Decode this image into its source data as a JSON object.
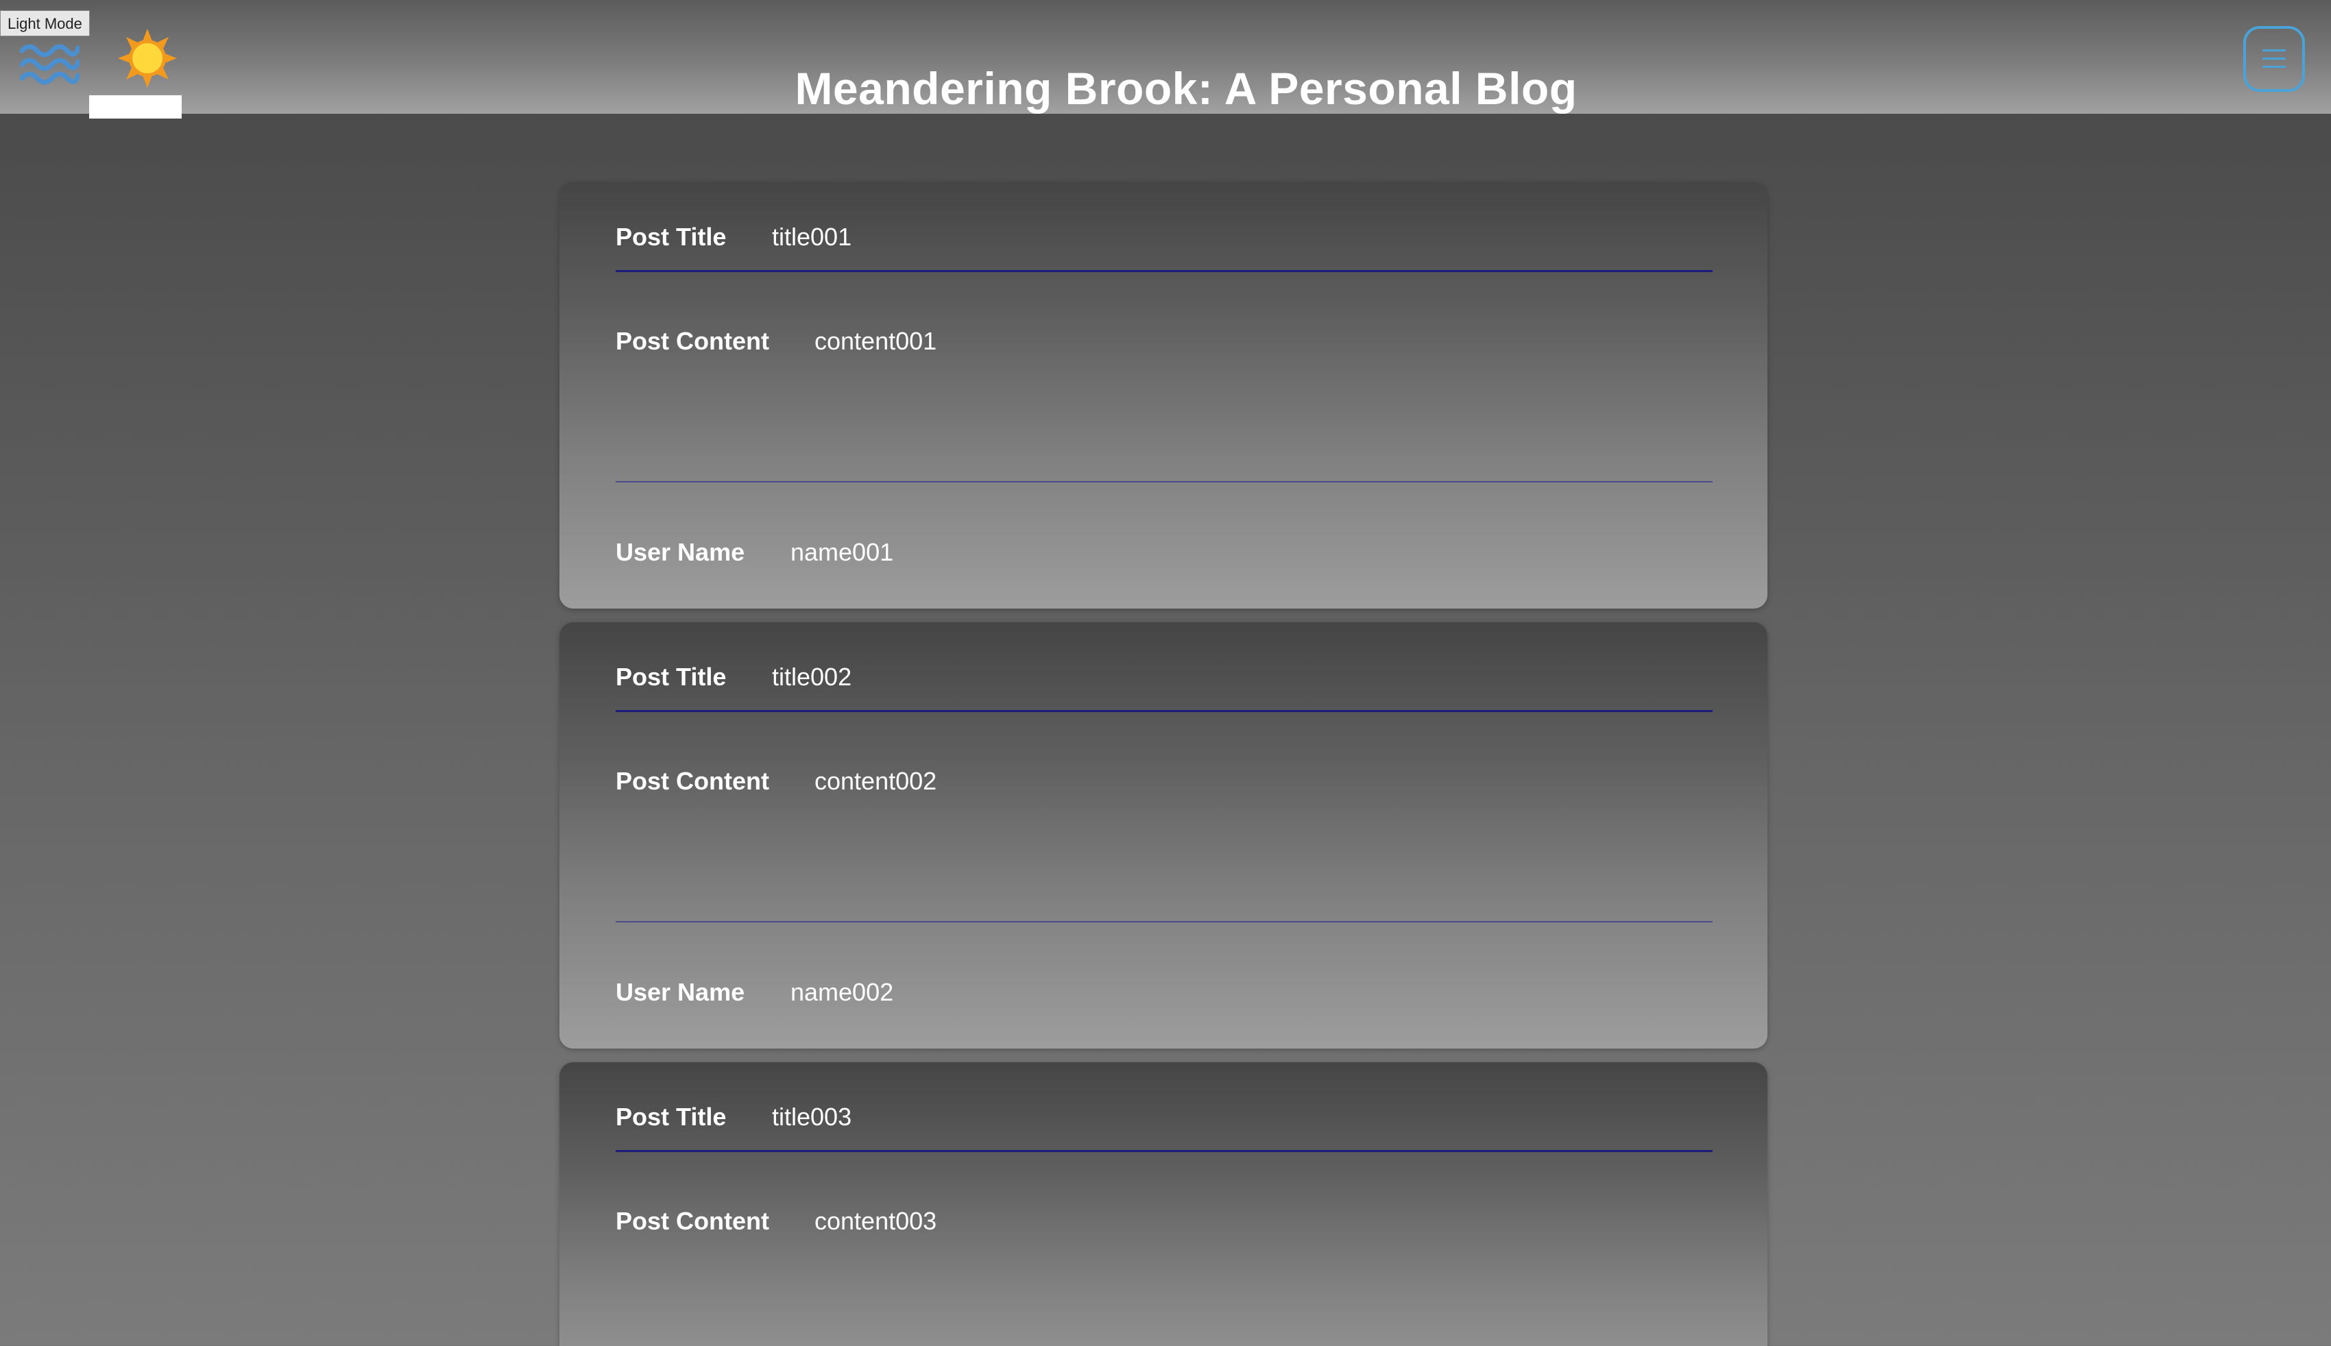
{
  "header": {
    "mode_tooltip": "Light Mode",
    "title": "Meandering Brook: A Personal Blog",
    "menu_icon": "hamburger-icon",
    "theme_icons": [
      "waves-icon",
      "sun-icon"
    ],
    "accent_color": "#4aa3d8"
  },
  "labels": {
    "post_title": "Post Title",
    "post_content": "Post Content",
    "user_name": "User Name"
  },
  "posts": [
    {
      "title": "title001",
      "content": "content001",
      "user": "name001"
    },
    {
      "title": "title002",
      "content": "content002",
      "user": "name002"
    },
    {
      "title": "title003",
      "content": "content003",
      "user": ""
    }
  ]
}
